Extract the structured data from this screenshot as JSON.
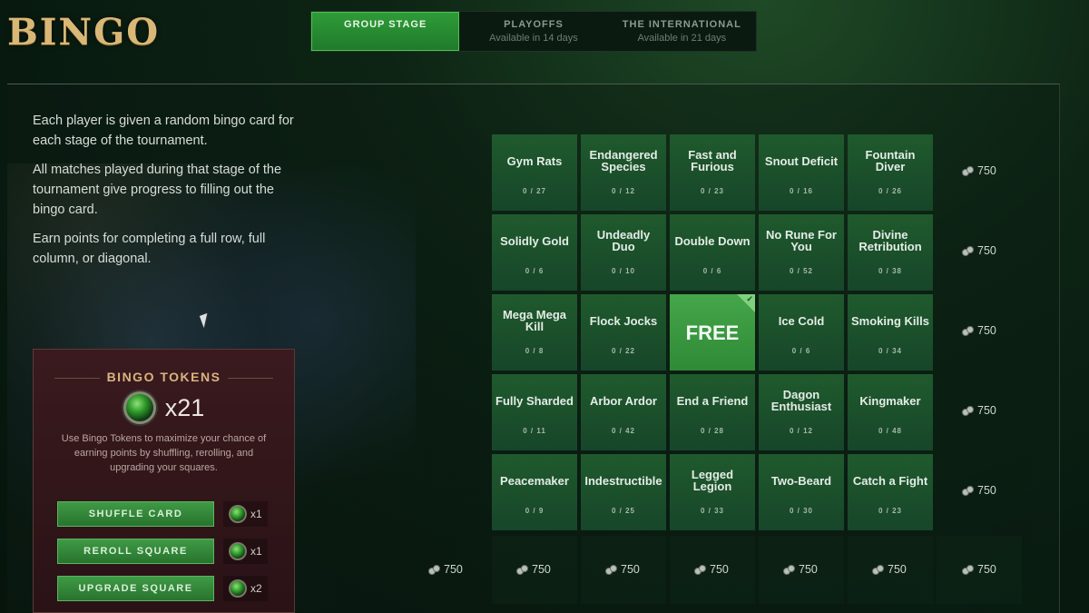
{
  "header": {
    "title": "BINGO",
    "tabs": [
      {
        "label": "GROUP STAGE",
        "sub": ""
      },
      {
        "label": "PLAYOFFS",
        "sub": "Available in 14 days"
      },
      {
        "label": "THE INTERNATIONAL",
        "sub": "Available in 21 days"
      }
    ]
  },
  "description": {
    "p1": "Each player is given a random bingo card for each stage of the tournament.",
    "p2": "All matches played during that stage of the tournament give progress to filling out the bingo card.",
    "p3": "Earn points for completing a full row, full column, or diagonal."
  },
  "tokens": {
    "title": "BINGO TOKENS",
    "count": "x21",
    "desc": "Use Bingo Tokens to maximize your chance of earning points by shuffling, rerolling, and upgrading your squares.",
    "actions": [
      {
        "label": "SHUFFLE CARD",
        "cost": "x1"
      },
      {
        "label": "REROLL SQUARE",
        "cost": "x1"
      },
      {
        "label": "UPGRADE SQUARE",
        "cost": "x2"
      }
    ]
  },
  "card": {
    "rows": [
      [
        {
          "name": "Gym Rats",
          "progress": "0 / 27"
        },
        {
          "name": "Endangered Species",
          "progress": "0 / 12"
        },
        {
          "name": "Fast and Furious",
          "progress": "0 / 23"
        },
        {
          "name": "Snout Deficit",
          "progress": "0 / 16"
        },
        {
          "name": "Fountain Diver",
          "progress": "0 / 26"
        }
      ],
      [
        {
          "name": "Solidly Gold",
          "progress": "0 / 6"
        },
        {
          "name": "Undeadly Duo",
          "progress": "0 / 10"
        },
        {
          "name": "Double Down",
          "progress": "0 / 6"
        },
        {
          "name": "No Rune For You",
          "progress": "0 / 52"
        },
        {
          "name": "Divine Retribution",
          "progress": "0 / 38"
        }
      ],
      [
        {
          "name": "Mega Mega Kill",
          "progress": "0 / 8"
        },
        {
          "name": "Flock Jocks",
          "progress": "0 / 22"
        },
        {
          "name": "FREE",
          "progress": ""
        },
        {
          "name": "Ice Cold",
          "progress": "0 / 6"
        },
        {
          "name": "Smoking Kills",
          "progress": "0 / 34"
        }
      ],
      [
        {
          "name": "Fully Sharded",
          "progress": "0 / 11"
        },
        {
          "name": "Arbor Ardor",
          "progress": "0 / 42"
        },
        {
          "name": "End a Friend",
          "progress": "0 / 28"
        },
        {
          "name": "Dagon Enthusiast",
          "progress": "0 / 12"
        },
        {
          "name": "Kingmaker",
          "progress": "0 / 48"
        }
      ],
      [
        {
          "name": "Peacemaker",
          "progress": "0 / 9"
        },
        {
          "name": "Indestructible",
          "progress": "0 / 25"
        },
        {
          "name": "Legged Legion",
          "progress": "0 / 33"
        },
        {
          "name": "Two-Beard",
          "progress": "0 / 30"
        },
        {
          "name": "Catch a Fight",
          "progress": "0 / 23"
        }
      ]
    ],
    "row_points": [
      "750",
      "750",
      "750",
      "750",
      "750"
    ],
    "diag_points": "750",
    "col_points": [
      "750",
      "750",
      "750",
      "750",
      "750"
    ],
    "diag2_points": "750"
  }
}
